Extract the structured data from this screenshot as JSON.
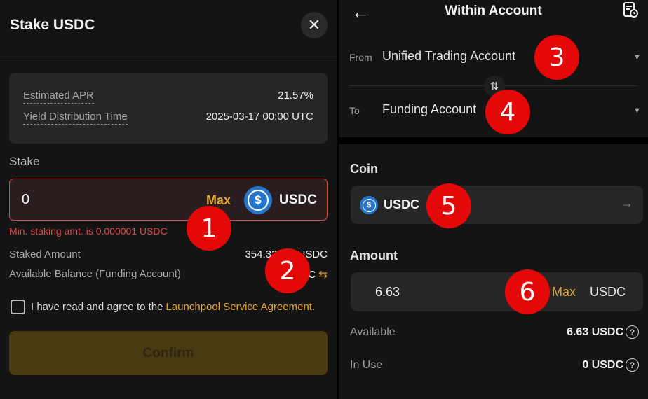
{
  "stake_modal": {
    "title": "Stake USDC",
    "close_icon": "close-icon",
    "info": [
      {
        "label": "Estimated APR",
        "value": "21.57%"
      },
      {
        "label": "Yield Distribution Time",
        "value": "2025-03-17 00:00 UTC"
      }
    ],
    "stake_label": "Stake",
    "stake_value": "0",
    "max_label": "Max",
    "coin_symbol": "$",
    "coin_name": "USDC",
    "error": "Min. staking amt. is 0.000001 USDC",
    "staked_amount_label": "Staked Amount",
    "staked_amount_value": "354.33 / 5,    USDC",
    "available_balance_label": "Available Balance (Funding Account)",
    "available_balance_value": "C",
    "transfer_icon": "⇆",
    "agree_text": "I have read and agree to the",
    "agree_link": "Launchpool Service Agreement.",
    "confirm_label": "Confirm",
    "accent_color": "#e6a629",
    "error_color": "#e04848"
  },
  "transfer": {
    "back_icon": "←",
    "title": "Within Account",
    "record_icon": "document-clock-icon",
    "from_tag": "From",
    "from_account": "Unified Trading Account",
    "to_tag": "To",
    "to_account": "Funding Account",
    "caret": "▼",
    "swap_icon": "⇅",
    "coin_label": "Coin",
    "coin_symbol": "$",
    "coin_name": "USDC",
    "coin_arrow": "→",
    "amount_label": "Amount",
    "amount_value": "6.63",
    "max_label": "Max",
    "amount_unit": "USDC",
    "available_label": "Available",
    "available_value": "6.63 USDC",
    "in_use_label": "In Use",
    "in_use_value": "0 USDC",
    "help_icon": "?"
  },
  "badges": [
    "1",
    "2",
    "3",
    "4",
    "5",
    "6"
  ]
}
